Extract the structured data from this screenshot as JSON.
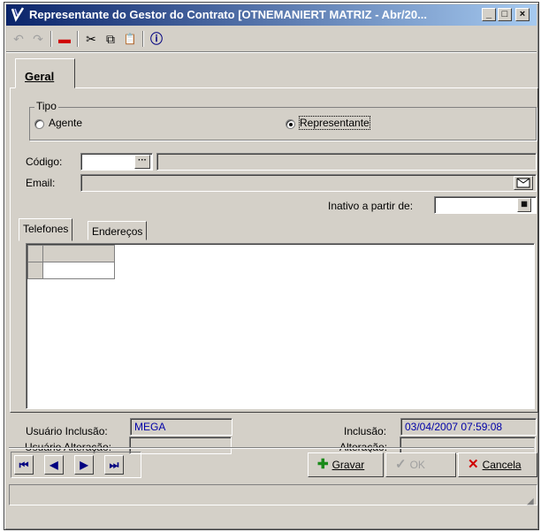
{
  "window": {
    "title": "Representante do Gestor do Contrato [OTNEMANIERT MATRIZ - Abr/20...",
    "app_icon_text": "MEGA",
    "minimize": "_",
    "maximize": "□",
    "close": "×"
  },
  "toolbar": {
    "undo_icon": "↶",
    "redo_icon": "↷",
    "delete_icon": "▬",
    "cut_icon": "✂",
    "copy_icon": "⧉",
    "paste_icon": "📋",
    "info_icon": "ⓘ"
  },
  "tabs": {
    "geral": "Geral"
  },
  "tipo": {
    "label": "Tipo",
    "options": [
      "Agente",
      "Representante"
    ],
    "selected": "Representante"
  },
  "form": {
    "codigo_label": "Código:",
    "codigo_value": "",
    "codigo_lookup": "···",
    "codigo_description": "",
    "email_label": "Email:",
    "email_value": "",
    "inativo_label": "Inativo a partir de:",
    "inativo_value": ""
  },
  "subtabs": [
    "Telefones",
    "Endereços"
  ],
  "audit": {
    "usuario_inclusao_label": "Usuário Inclusão:",
    "usuario_inclusao_value": "MEGA",
    "inclusao_label": "Inclusão:",
    "inclusao_value": "03/04/2007 07:59:08",
    "usuario_alteracao_label": "Usuário Alteração:",
    "usuario_alteracao_value": "",
    "alteracao_label": "Alteração:",
    "alteracao_value": ""
  },
  "navigation": {
    "first": "⏮",
    "prev": "◀",
    "next": "▶",
    "last": "⏭"
  },
  "actions": {
    "gravar": "Gravar",
    "ok": "OK",
    "cancela": "Cancela"
  },
  "colors": {
    "title_bar_start": "#0a246a",
    "window_bg": "#d4d0c8",
    "field_value": "#0000a8",
    "gravar_icon": "#1a8a1a",
    "cancela_icon": "#d00000"
  }
}
